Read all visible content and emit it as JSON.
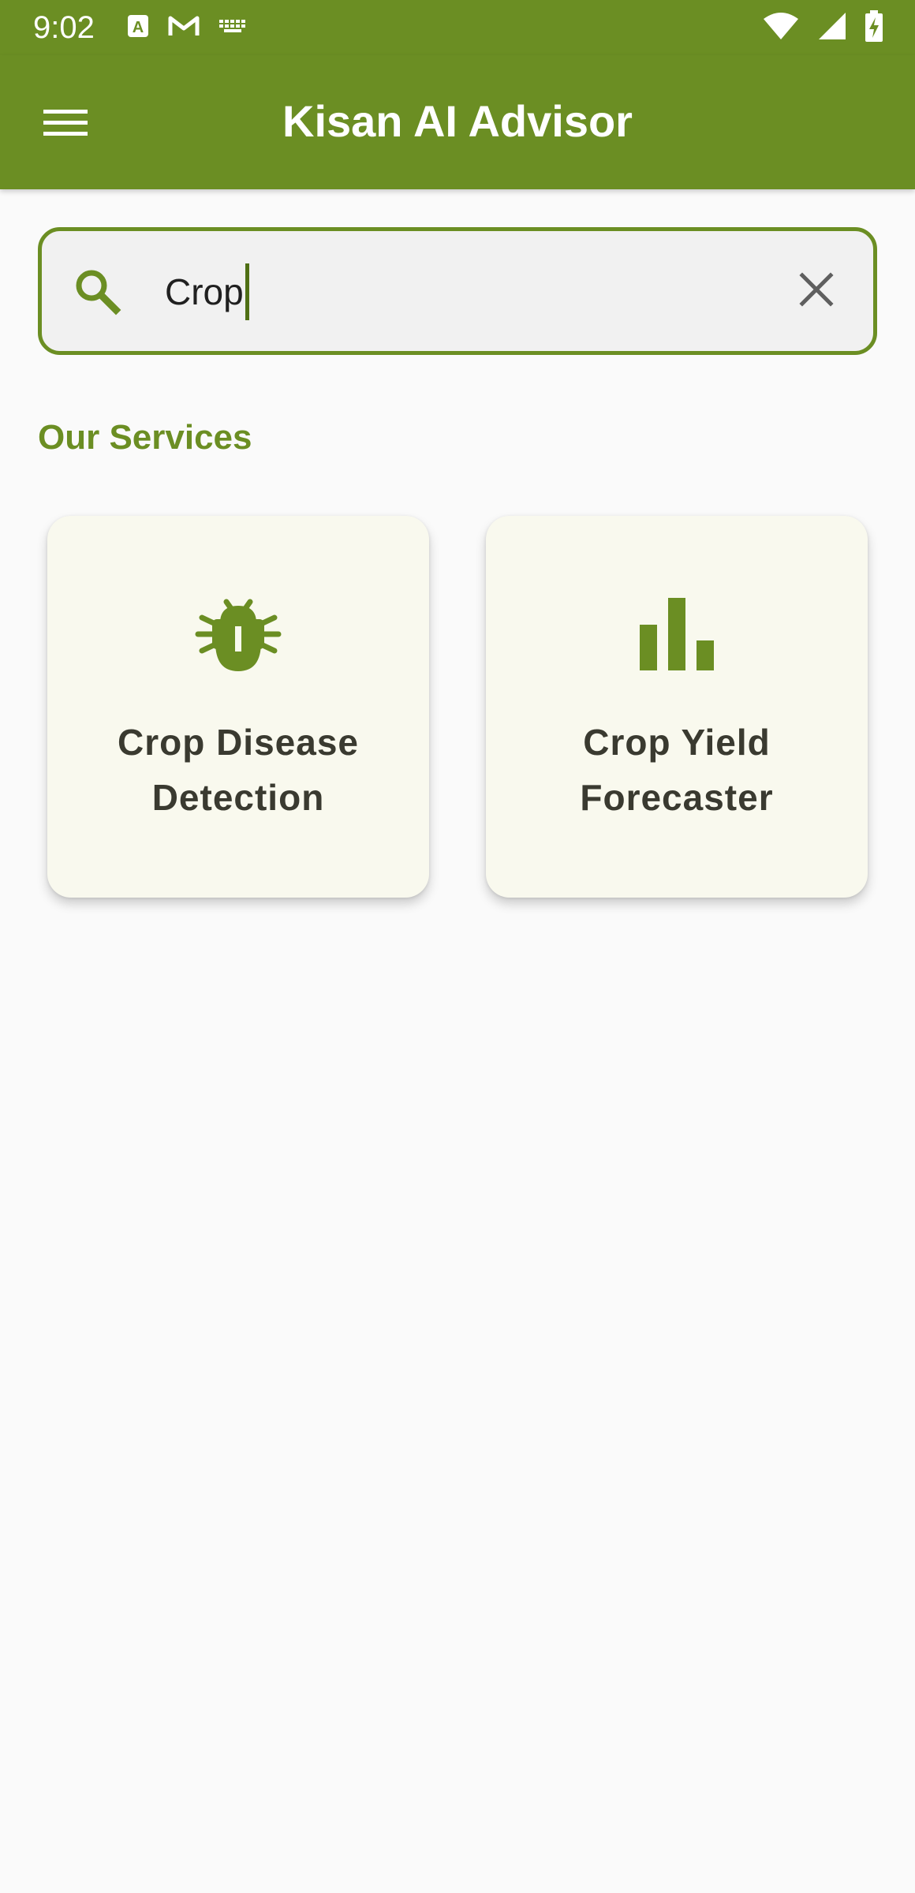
{
  "status_bar": {
    "time": "9:02",
    "icons": [
      "a-app-icon",
      "gmail-icon",
      "keyboard-icon",
      "wifi-icon",
      "signal-icon",
      "battery-charging-icon"
    ]
  },
  "app_bar": {
    "title": "Kisan AI Advisor",
    "menu_icon": "hamburger-menu-icon",
    "background_color": "#6b8e23"
  },
  "search": {
    "value": "Crop",
    "search_icon": "search-icon",
    "clear_icon": "close-icon"
  },
  "services": {
    "title": "Our Services",
    "items": [
      {
        "label": "Crop Disease Detection",
        "icon": "bug-icon"
      },
      {
        "label": "Crop Yield Forecaster",
        "icon": "bar-chart-icon"
      }
    ]
  },
  "colors": {
    "accent": "#6b8e23",
    "card_background": "#f9f9ee",
    "page_background": "#fafafa"
  }
}
